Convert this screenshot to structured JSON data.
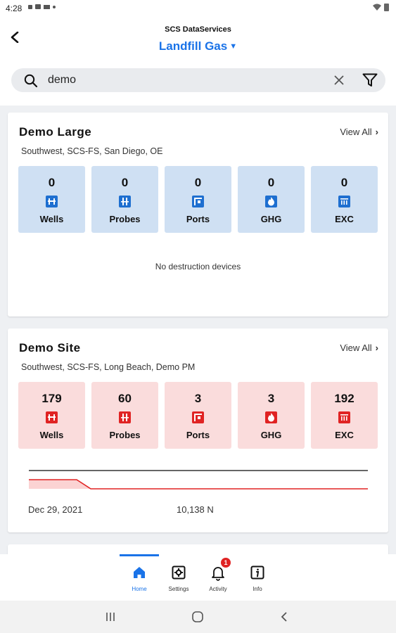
{
  "status_bar": {
    "time": "4:28"
  },
  "header": {
    "app_name": "SCS DataServices",
    "site_selector": "Landfill Gas"
  },
  "search": {
    "value": "demo"
  },
  "cards": [
    {
      "title": "Demo Large",
      "view_all": "View All",
      "subtitle": "Southwest, SCS-FS, San Diego, OE",
      "status": "blue",
      "tiles": [
        {
          "count": "0",
          "label": "Wells"
        },
        {
          "count": "0",
          "label": "Probes"
        },
        {
          "count": "0",
          "label": "Ports"
        },
        {
          "count": "0",
          "label": "GHG"
        },
        {
          "count": "0",
          "label": "EXC"
        }
      ],
      "message": "No destruction devices"
    },
    {
      "title": "Demo Site",
      "view_all": "View All",
      "subtitle": "Southwest, SCS-FS, Long Beach, Demo PM",
      "status": "red",
      "tiles": [
        {
          "count": "179",
          "label": "Wells"
        },
        {
          "count": "60",
          "label": "Probes"
        },
        {
          "count": "3",
          "label": "Ports"
        },
        {
          "count": "3",
          "label": "GHG"
        },
        {
          "count": "192",
          "label": "EXC"
        }
      ],
      "trend_date": "Dec 29, 2021",
      "trend_value": "10,138 N"
    }
  ],
  "bottom_nav": [
    {
      "label": "Home",
      "icon": "home-icon",
      "active": true
    },
    {
      "label": "Settings",
      "icon": "settings-icon"
    },
    {
      "label": "Activity",
      "icon": "bell-icon",
      "badge": "1"
    },
    {
      "label": "Info",
      "icon": "info-icon"
    }
  ],
  "colors": {
    "accent": "#1a73e8",
    "ok_tile": "#cfe0f3",
    "alert_tile": "#fadcdc",
    "ok_icon": "#1e6fd0",
    "alert_icon": "#e02323"
  }
}
